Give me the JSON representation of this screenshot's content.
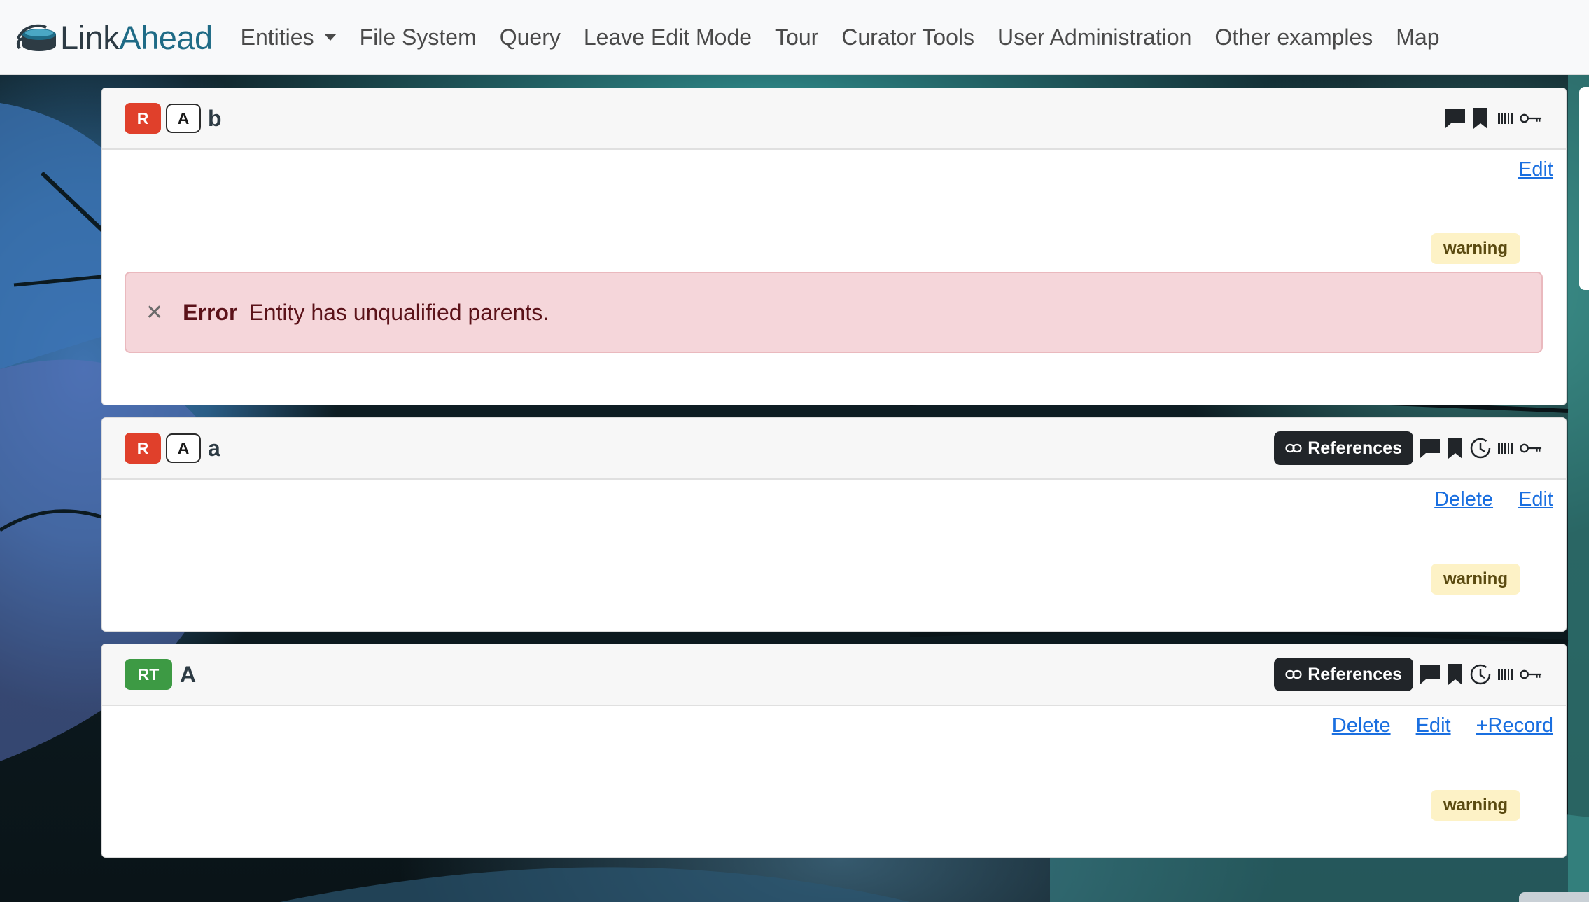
{
  "navbar": {
    "brand_left": "Link",
    "brand_right": "Ahead",
    "items": [
      {
        "label": "Entities",
        "dropdown": true
      },
      {
        "label": "File System"
      },
      {
        "label": "Query"
      },
      {
        "label": "Leave Edit Mode"
      },
      {
        "label": "Tour"
      },
      {
        "label": "Curator Tools"
      },
      {
        "label": "User Administration"
      },
      {
        "label": "Other examples"
      },
      {
        "label": "Map"
      }
    ]
  },
  "entities": [
    {
      "role": "R",
      "parent": "A",
      "name": "b",
      "tools": [
        "comment-icon",
        "bookmark-icon",
        "barcode-icon",
        "key-icon"
      ],
      "actions": [
        "Edit"
      ],
      "warning": "warning",
      "error": {
        "title": "Error",
        "message": "Entity has unqualified parents."
      }
    },
    {
      "role": "R",
      "parent": "A",
      "name": "a",
      "references_label": "References",
      "tools": [
        "comment-icon",
        "bookmark-icon",
        "history-icon",
        "barcode-icon",
        "key-icon"
      ],
      "actions": [
        "Delete",
        "Edit"
      ],
      "warning": "warning"
    },
    {
      "role": "RT",
      "name": "A",
      "references_label": "References",
      "tools": [
        "comment-icon",
        "bookmark-icon",
        "history-icon",
        "barcode-icon",
        "key-icon"
      ],
      "actions": [
        "Delete",
        "Edit",
        "+Record"
      ],
      "warning": "warning"
    }
  ],
  "colors": {
    "record_role": "#e0402b",
    "recordtype_role": "#3d9a44",
    "link": "#1a6fe0",
    "warning_bg": "#fdf2c6",
    "error_bg": "#f5d6da"
  }
}
